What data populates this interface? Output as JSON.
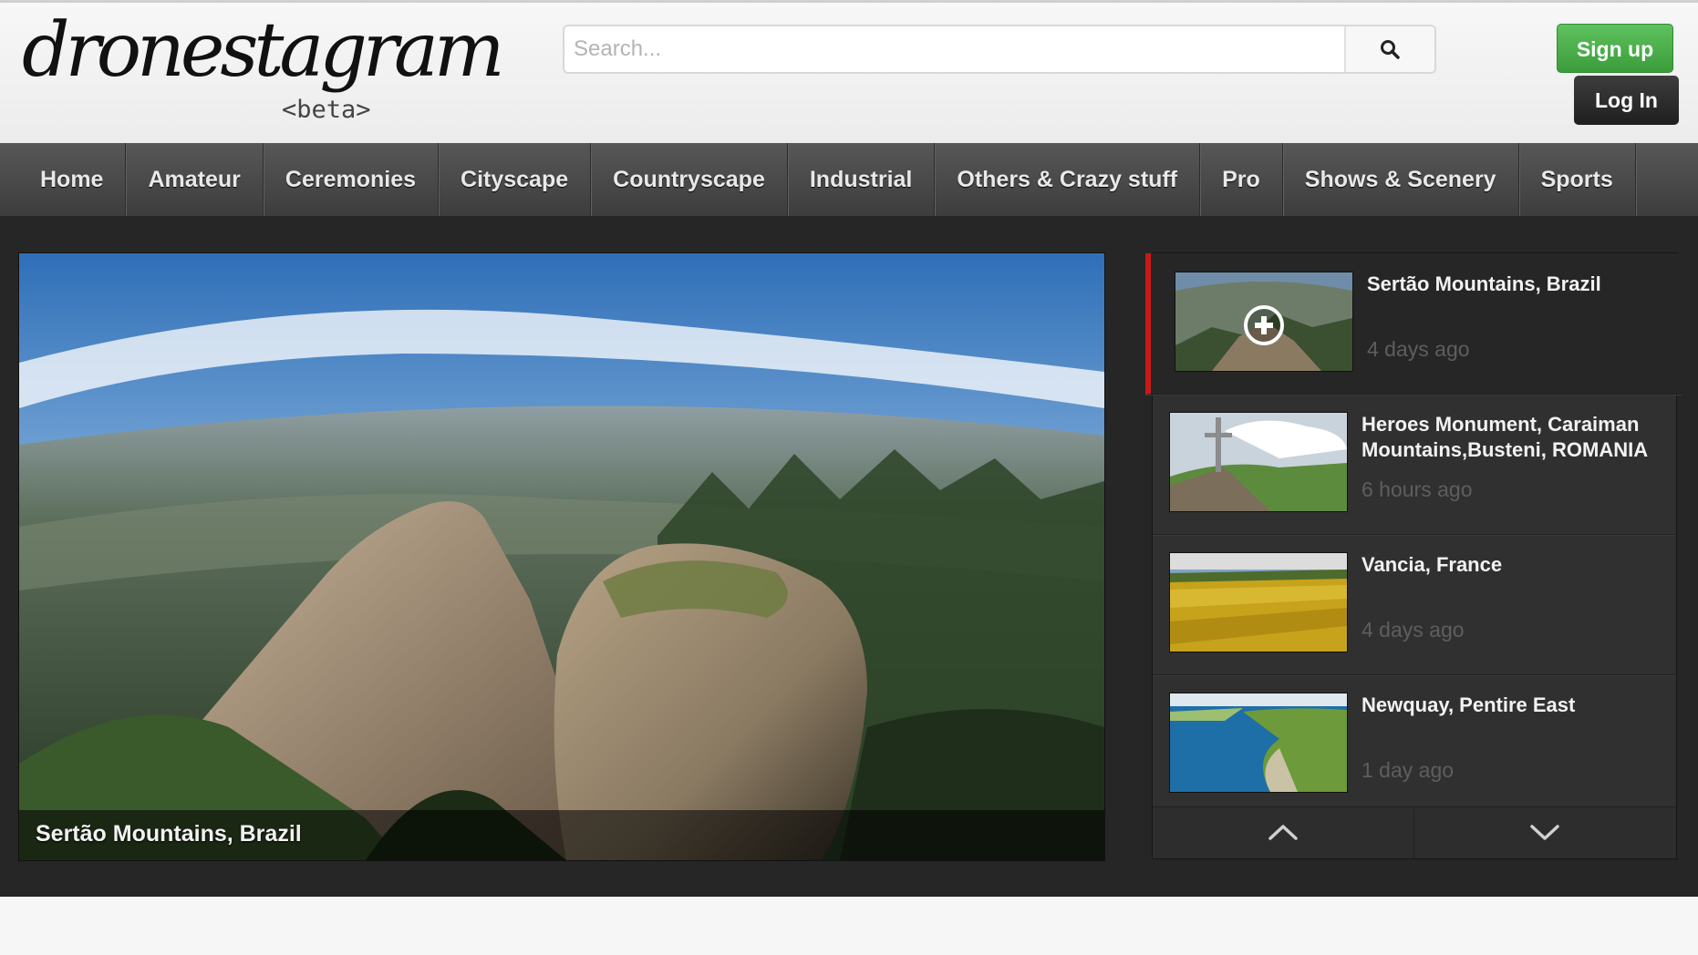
{
  "header": {
    "logo_text": "dronestagram",
    "logo_beta": "<beta>",
    "search": {
      "placeholder": "Search...",
      "value": "",
      "icon": "search-icon"
    },
    "signup_label": "Sign up",
    "login_label": "Log In"
  },
  "nav": {
    "items": [
      {
        "label": "Home"
      },
      {
        "label": "Amateur"
      },
      {
        "label": "Ceremonies"
      },
      {
        "label": "Cityscape"
      },
      {
        "label": "Countryscape"
      },
      {
        "label": "Industrial"
      },
      {
        "label": "Others & Crazy stuff"
      },
      {
        "label": "Pro"
      },
      {
        "label": "Shows & Scenery"
      },
      {
        "label": "Sports"
      }
    ]
  },
  "featured": {
    "caption": "Sertão Mountains, Brazil"
  },
  "playlist": {
    "items": [
      {
        "title": "Sertão Mountains, Brazil",
        "time": "4 days ago",
        "active": true
      },
      {
        "title": "Heroes Monument, Caraiman Mountains,Busteni, ROMANIA",
        "time": "6 hours ago",
        "active": false
      },
      {
        "title": "Vancia, France",
        "time": "4 days ago",
        "active": false
      },
      {
        "title": "Newquay, Pentire East",
        "time": "1 day ago",
        "active": false
      }
    ],
    "up_icon": "chevron-up-icon",
    "down_icon": "chevron-down-icon"
  },
  "colors": {
    "signup_green": "#4cb04c",
    "nav_bg": "#4a4a4a",
    "main_bg": "#262626",
    "active_marker": "#c81919"
  }
}
